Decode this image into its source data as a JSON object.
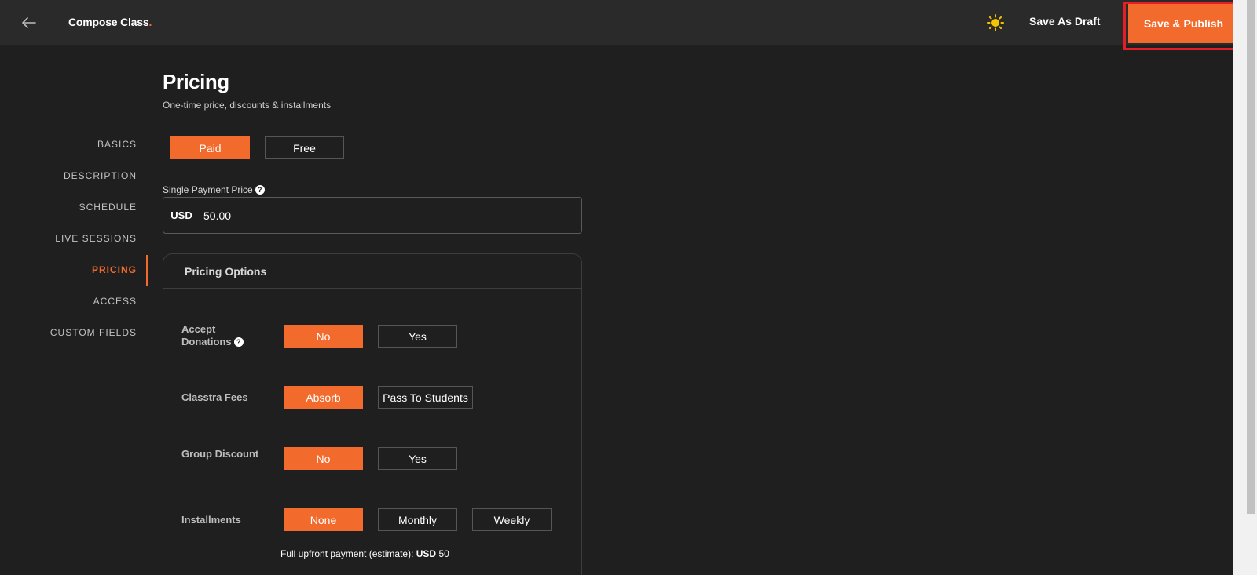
{
  "header": {
    "title": "Compose Class",
    "title_dot": ".",
    "save_draft_label": "Save As Draft",
    "publish_label": "Save & Publish",
    "back_icon": "arrow-left-icon",
    "theme_icon": "sun-icon"
  },
  "page": {
    "title": "Pricing",
    "subtitle": "One-time price, discounts & installments"
  },
  "sidenav": {
    "items": [
      {
        "label": "BASICS",
        "active": false
      },
      {
        "label": "DESCRIPTION",
        "active": false
      },
      {
        "label": "SCHEDULE",
        "active": false
      },
      {
        "label": "LIVE SESSIONS",
        "active": false
      },
      {
        "label": "PRICING",
        "active": true
      },
      {
        "label": "ACCESS",
        "active": false
      },
      {
        "label": "CUSTOM FIELDS",
        "active": false
      }
    ]
  },
  "payment_type": {
    "options": [
      "Paid",
      "Free"
    ],
    "selected": "Paid"
  },
  "price": {
    "label": "Single Payment Price",
    "currency": "USD",
    "value": "50.00"
  },
  "options": {
    "title": "Pricing Options",
    "donations": {
      "label_line1": "Accept",
      "label_line2": "Donations",
      "options": [
        "No",
        "Yes"
      ],
      "selected": "No"
    },
    "fees": {
      "label": "Classtra Fees",
      "options": [
        "Absorb",
        "Pass To Students"
      ],
      "selected": "Absorb"
    },
    "group_discount": {
      "label": "Group Discount",
      "options": [
        "No",
        "Yes"
      ],
      "selected": "No"
    },
    "installments": {
      "label": "Installments",
      "options": [
        "None",
        "Monthly",
        "Weekly"
      ],
      "selected": "None"
    },
    "estimate_prefix": "Full upfront payment (estimate):",
    "estimate_currency": "USD",
    "estimate_value": "50"
  },
  "colors": {
    "accent": "#f26b2d",
    "background": "#1f1f1f",
    "topbar": "#2a2a2a",
    "highlight": "#e41e26"
  }
}
